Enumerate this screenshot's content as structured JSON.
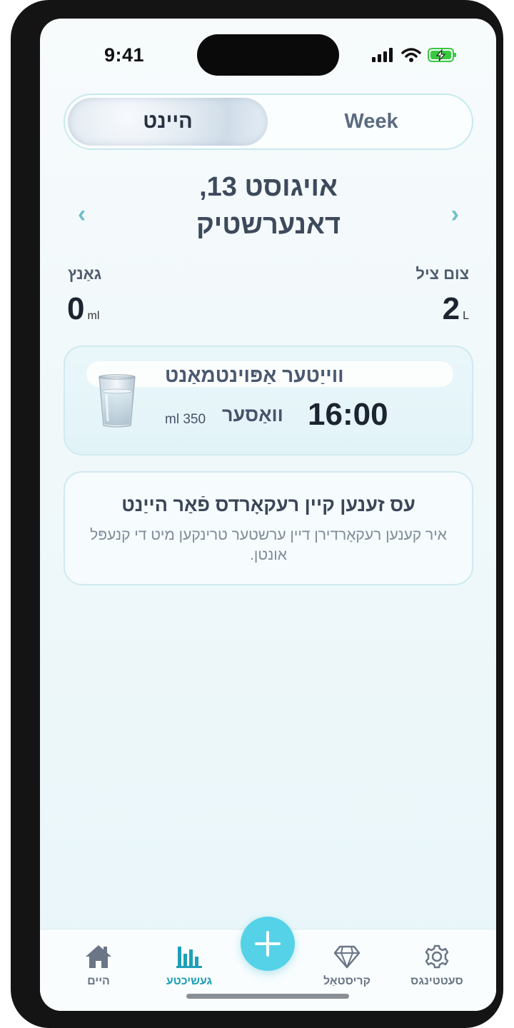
{
  "status_bar": {
    "time": "9:41"
  },
  "segmented": {
    "today_label": "היינט",
    "week_label": "Week"
  },
  "date_nav": {
    "title_line1": "אויגוסט 13,",
    "title_line2": "דאנערשטיק",
    "prev_icon": "chevron-left-icon",
    "next_icon": "chevron-right-icon"
  },
  "stats": {
    "goal": {
      "label": "צום ציל",
      "value": "2",
      "unit": "L"
    },
    "total": {
      "label": "גאַנץ",
      "value": "0",
      "unit": "ml"
    }
  },
  "reminder": {
    "title": "ווייַטער אַפּוינטמאַנט",
    "time": "16:00",
    "drink": "וואַסער",
    "amount": "ml 350",
    "icon": "water-glass-icon"
  },
  "empty_state": {
    "title": "עס זענען קיין רעקאָרדס פֿאַר הייַנט",
    "text": "איר קענען רעקאָרדירן דיין ערשטער טרינקען מיט די קנעפּל אונטן."
  },
  "tabbar": {
    "items": [
      {
        "label": "היים",
        "icon": "home-icon"
      },
      {
        "label": "געשיכטע",
        "icon": "bar-chart-icon"
      },
      {
        "label": "קריסטאַל",
        "icon": "diamond-icon"
      },
      {
        "label": "סעטטינגס",
        "icon": "gear-icon"
      }
    ],
    "active_index": 1,
    "add_icon": "plus-icon"
  },
  "colors": {
    "accent": "#55d2e7",
    "active_tab": "#1e9fb7",
    "chevron": "#6fbec9"
  }
}
